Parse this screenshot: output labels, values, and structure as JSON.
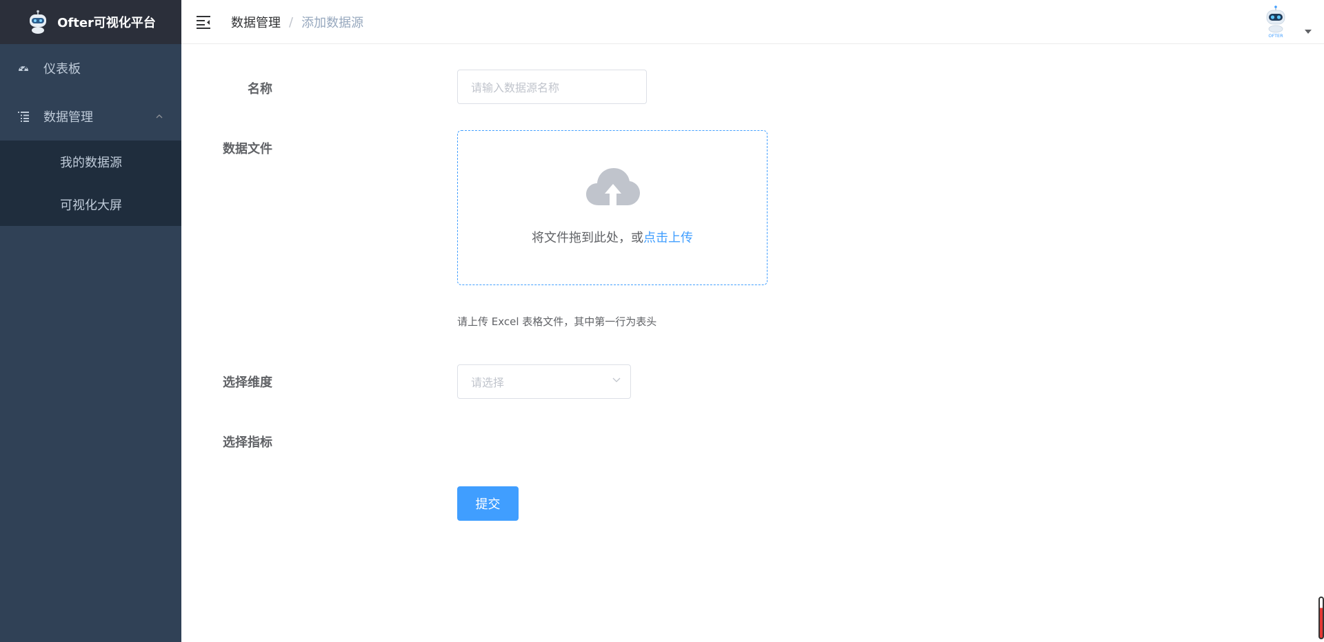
{
  "app": {
    "title": "Ofter可视化平台",
    "logo_icon": "robot-logo-icon"
  },
  "sidebar": {
    "items": [
      {
        "label": "仪表板",
        "icon": "dashboard-icon"
      },
      {
        "label": "数据管理",
        "icon": "list-icon",
        "expanded": true,
        "children": [
          {
            "label": "我的数据源"
          },
          {
            "label": "可视化大屏"
          }
        ]
      }
    ]
  },
  "navbar": {
    "toggle_icon": "hamburger-icon",
    "breadcrumb": [
      "数据管理",
      "添加数据源"
    ],
    "separator": "/",
    "avatar_icon": "robot-avatar-icon",
    "avatar_text": "OFTER"
  },
  "form": {
    "name_label": "名称",
    "name_placeholder": "请输入数据源名称",
    "file_label": "数据文件",
    "upload_text": "将文件拖到此处，或",
    "upload_link": "点击上传",
    "upload_tip": "请上传 Excel 表格文件，其中第一行为表头",
    "dimension_label": "选择维度",
    "dimension_placeholder": "请选择",
    "metric_label": "选择指标",
    "submit_label": "提交"
  },
  "colors": {
    "sidebar_bg": "#304156",
    "submenu_bg": "#1f2d3d",
    "brand_bg": "#2b2f3a",
    "accent": "#409eff"
  }
}
